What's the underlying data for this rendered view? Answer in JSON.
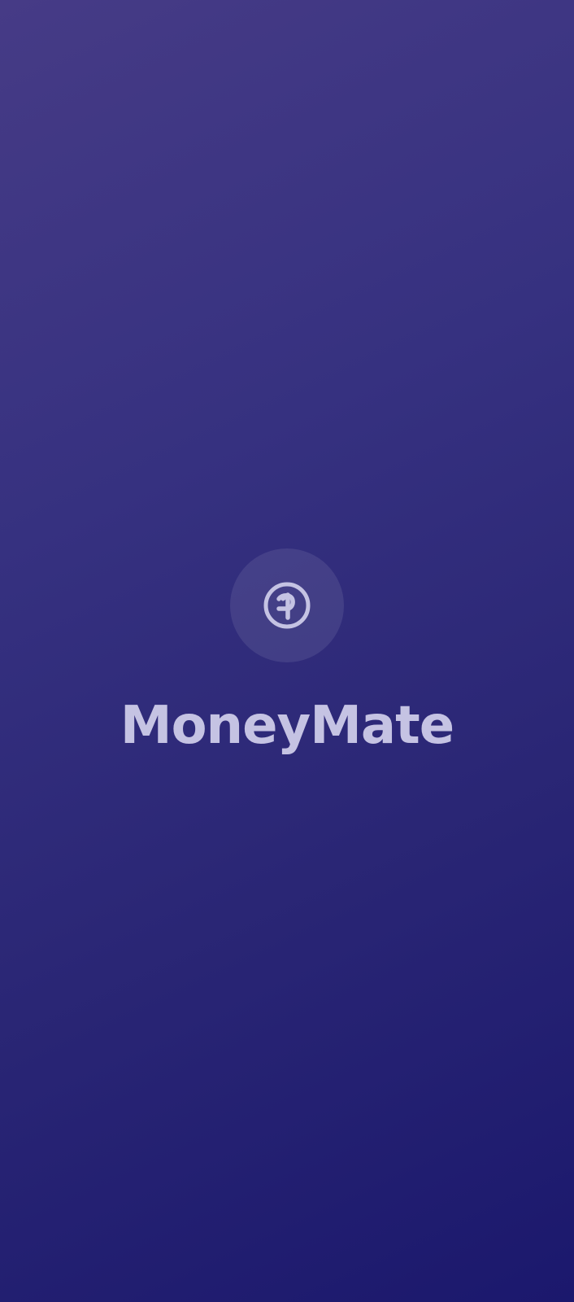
{
  "app": {
    "name": "MoneyMate",
    "logo_icon": "coin-icon"
  },
  "colors": {
    "gradient_start": "#463b86",
    "gradient_end": "#1b186d",
    "text": "#c5c3e3",
    "icon": "#c5c3e3"
  }
}
